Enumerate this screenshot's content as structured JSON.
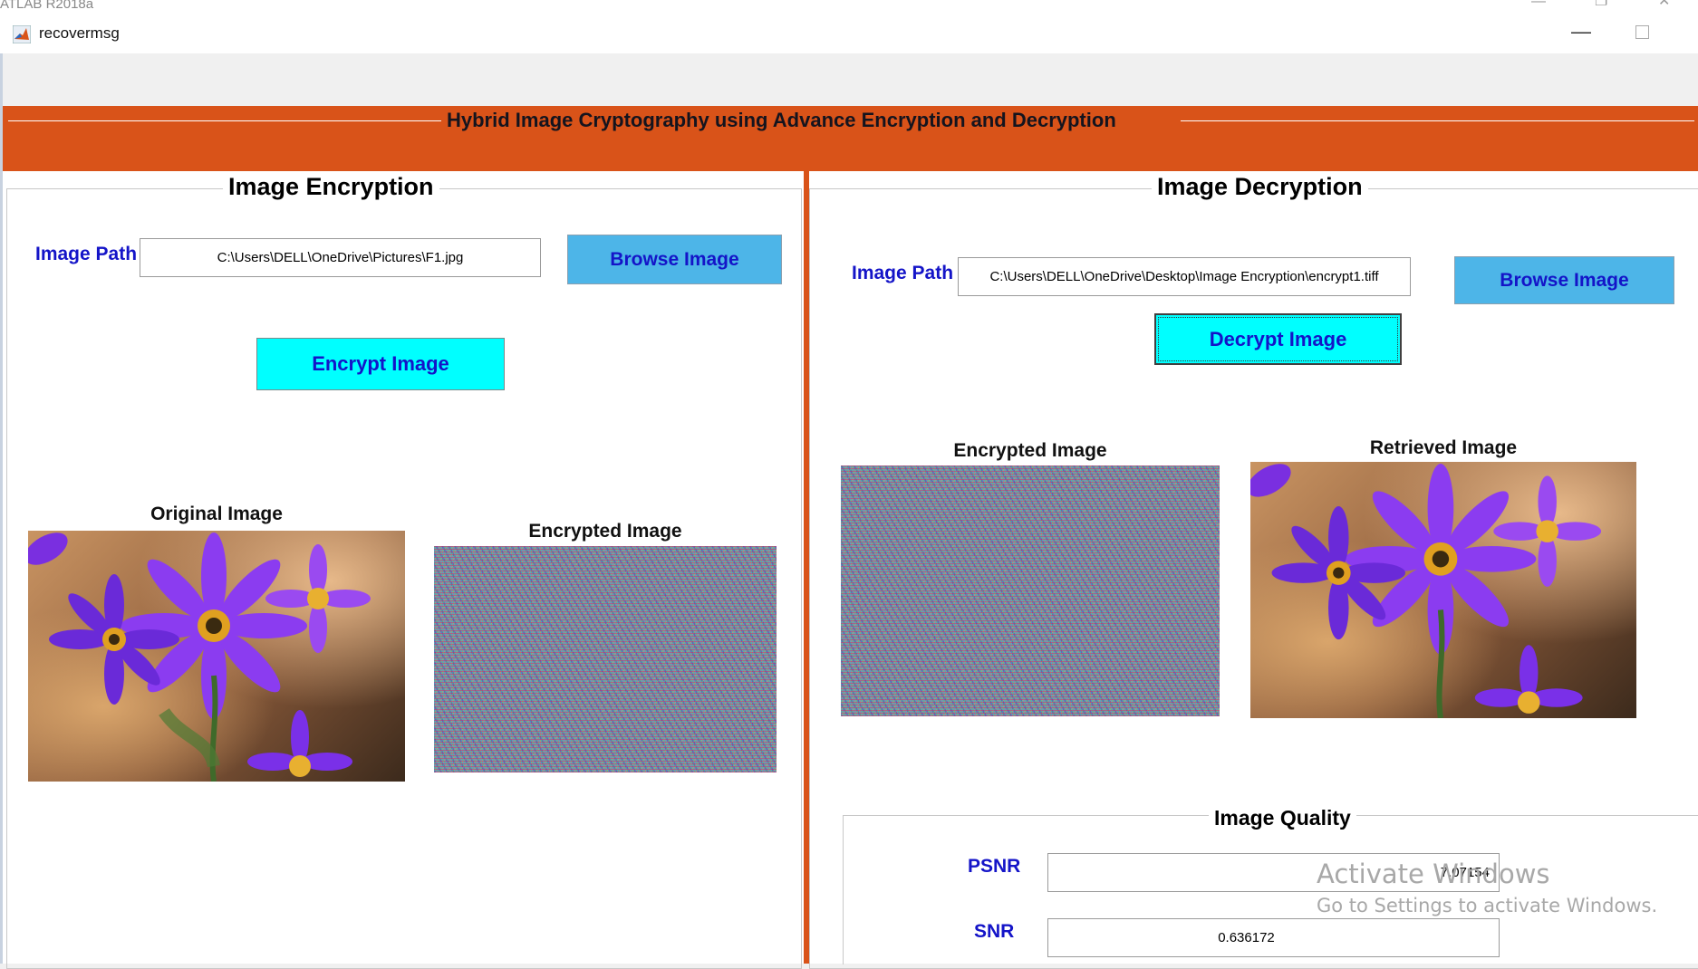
{
  "outer_window": {
    "title": "ATLAB R2018a"
  },
  "window": {
    "title": "recovermsg"
  },
  "header": {
    "title": "Hybrid Image Cryptography using Advance Encryption and Decryption"
  },
  "colors": {
    "banner": "#d95319",
    "button_blue": "#4db5e8",
    "button_cyan": "#00ffff",
    "label_blue": "#1414c8"
  },
  "encryption": {
    "title": "Image Encryption",
    "path_label": "Image Path",
    "path_value": "C:\\Users\\DELL\\OneDrive\\Pictures\\F1.jpg",
    "browse_label": "Browse Image",
    "encrypt_label": "Encrypt Image",
    "original_title": "Original Image",
    "encrypted_title": "Encrypted Image"
  },
  "decryption": {
    "title": "Image Decryption",
    "path_label": "Image Path",
    "path_value": "C:\\Users\\DELL\\OneDrive\\Desktop\\Image Encryption\\encrypt1.tiff",
    "browse_label": "Browse Image",
    "decrypt_label": "Decrypt Image",
    "encrypted_title": "Encrypted  Image",
    "retrieved_title": "Retrieved Image"
  },
  "quality": {
    "title": "Image Quality",
    "psnr_label": "PSNR",
    "psnr_value": "7.07154",
    "snr_label": "SNR",
    "snr_value": "0.636172"
  },
  "watermark": {
    "line1": "Activate Windows",
    "line2": "Go to Settings to activate Windows."
  }
}
